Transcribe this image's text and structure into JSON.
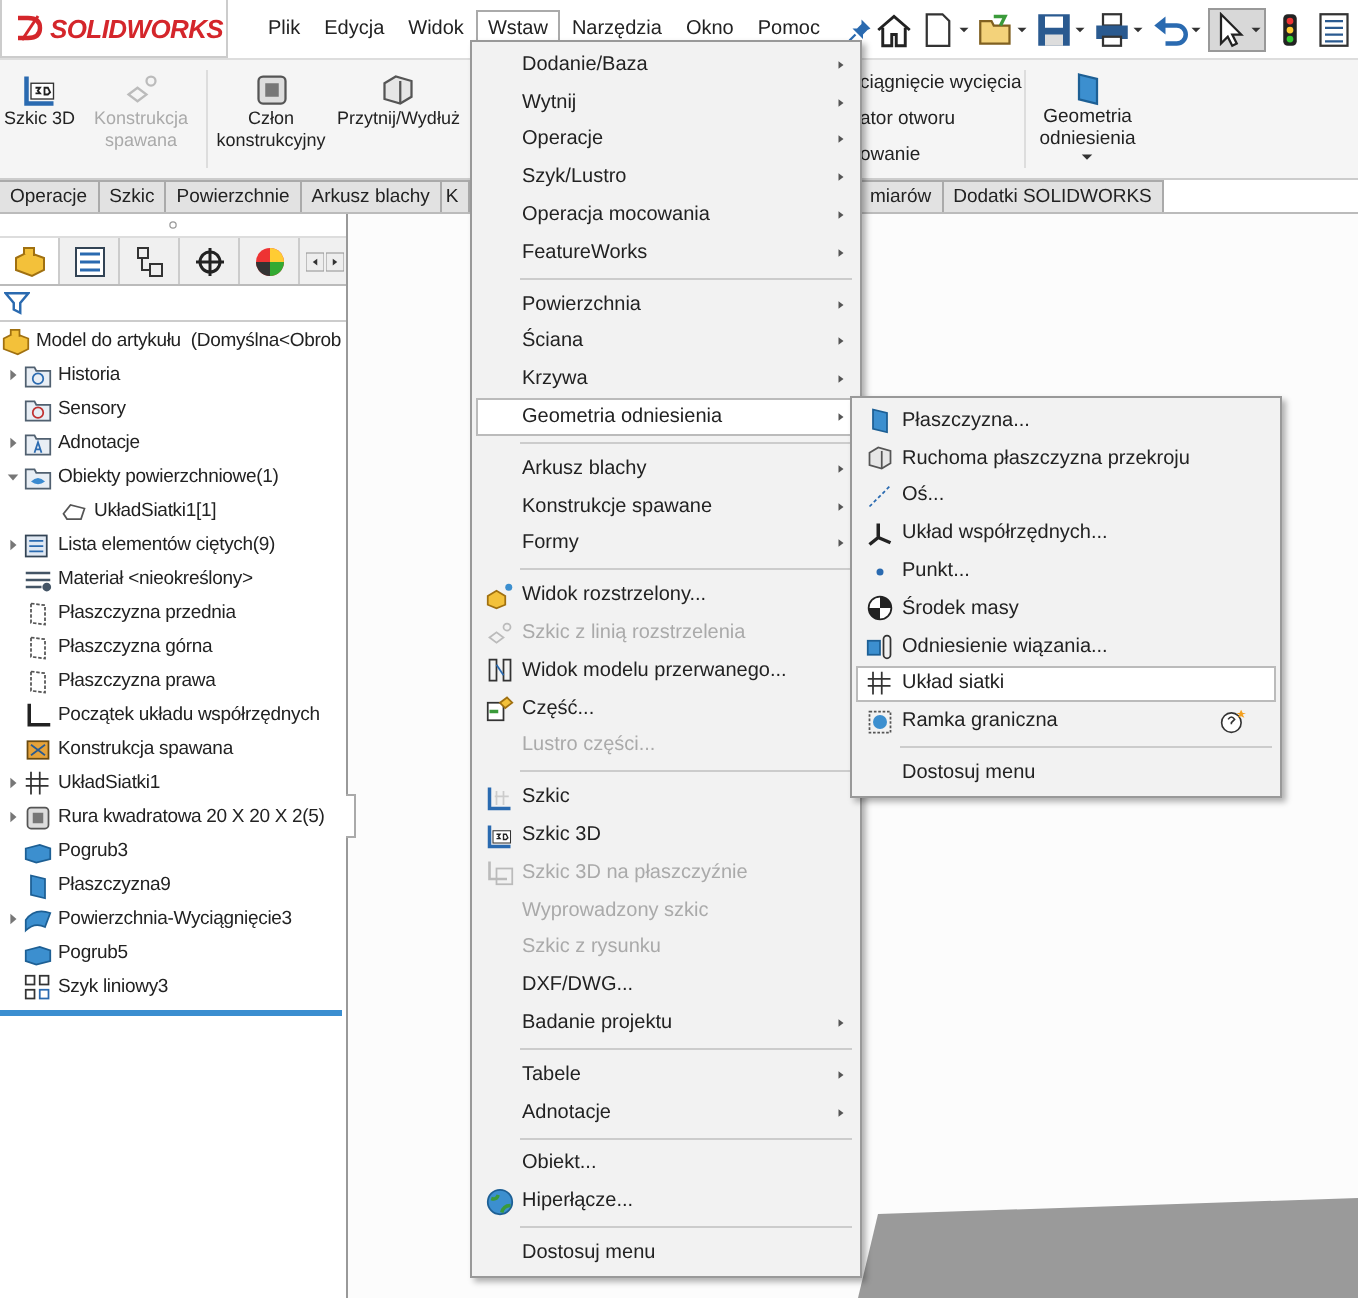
{
  "logo": {
    "text": "SOLIDWORKS"
  },
  "menu_bar": [
    {
      "label": "Plik",
      "selected": false
    },
    {
      "label": "Edycja",
      "selected": false
    },
    {
      "label": "Widok",
      "selected": false
    },
    {
      "label": "Wstaw",
      "selected": true
    },
    {
      "label": "Narzędzia",
      "selected": false
    },
    {
      "label": "Okno",
      "selected": false
    },
    {
      "label": "Pomoc",
      "selected": false
    }
  ],
  "ribbon": {
    "buttons": [
      {
        "label": "Szkic 3D",
        "kind": "sketch3d",
        "disabled": false
      },
      {
        "label": "Konstrukcja spawana",
        "kind": "weldment",
        "disabled": true
      },
      {
        "label": "Człon konstrukcyjny",
        "kind": "member",
        "disabled": false
      },
      {
        "label": "Przytnij/Wydłuż",
        "kind": "trim",
        "disabled": false
      }
    ],
    "partial_labels": [
      "ciągnięcie wycięcia",
      "ator otworu",
      "owanie"
    ],
    "geometry_button": {
      "label": "Geometria odniesienia"
    }
  },
  "ribbon_tabs": [
    "Operacje",
    "Szkic",
    "Powierzchnie",
    "Arkusz blachy",
    "K"
  ],
  "ribbon_tabs_right": [
    "miarów",
    "Dodatki SOLIDWORKS"
  ],
  "panel_tabs": [
    {
      "kind": "part",
      "selected": true
    },
    {
      "kind": "list",
      "selected": false
    },
    {
      "kind": "config",
      "selected": false
    },
    {
      "kind": "target",
      "selected": false
    },
    {
      "kind": "appearance",
      "selected": false
    }
  ],
  "feature_tree": {
    "root": {
      "label": "Model do artykułu  (Domyślna<Obrob",
      "kind": "part"
    },
    "items": [
      {
        "label": "Historia",
        "kind": "folder-history",
        "expanded": false
      },
      {
        "label": "Sensory",
        "kind": "folder-sensor"
      },
      {
        "label": "Adnotacje",
        "kind": "folder-annot",
        "expanded": false
      },
      {
        "label": "Obiekty powierzchniowe(1)",
        "kind": "folder-surface",
        "expanded": true,
        "children": [
          {
            "label": "UkładSiatki1[1]",
            "kind": "outline"
          }
        ]
      },
      {
        "label": "Lista elementów ciętych(9)",
        "kind": "cutlist",
        "expanded": false
      },
      {
        "label": "Materiał <nieokreślony>",
        "kind": "material"
      },
      {
        "label": "Płaszczyzna przednia",
        "kind": "plane"
      },
      {
        "label": "Płaszczyzna górna",
        "kind": "plane"
      },
      {
        "label": "Płaszczyzna prawa",
        "kind": "plane"
      },
      {
        "label": "Początek układu współrzędnych",
        "kind": "origin"
      },
      {
        "label": "Konstrukcja spawana",
        "kind": "weldment"
      },
      {
        "label": "UkładSiatki1",
        "kind": "grid",
        "expanded": false
      },
      {
        "label": "Rura kwadratowa 20 X 20 X 2(5)",
        "kind": "tube",
        "expanded": false
      },
      {
        "label": "Pogrub3",
        "kind": "thicken"
      },
      {
        "label": "Płaszczyzna9",
        "kind": "plane-solid"
      },
      {
        "label": "Powierzchnia-Wyciągnięcie3",
        "kind": "surface",
        "expanded": false
      },
      {
        "label": "Pogrub5",
        "kind": "thicken"
      },
      {
        "label": "Szyk liniowy3",
        "kind": "pattern"
      }
    ]
  },
  "insert_menu": {
    "items": [
      {
        "kind": "item",
        "label": "Dodanie/Baza",
        "submenu": true,
        "disabled": false,
        "selected": false
      },
      {
        "kind": "item",
        "label": "Wytnij",
        "submenu": true,
        "disabled": false,
        "selected": false
      },
      {
        "kind": "item",
        "label": "Operacje",
        "submenu": true,
        "disabled": false,
        "selected": false
      },
      {
        "kind": "item",
        "label": "Szyk/Lustro",
        "submenu": true,
        "disabled": false,
        "selected": false
      },
      {
        "kind": "item",
        "label": "Operacja mocowania",
        "submenu": true,
        "disabled": false,
        "selected": false
      },
      {
        "kind": "item",
        "label": "FeatureWorks",
        "submenu": true,
        "disabled": false,
        "selected": false
      },
      {
        "kind": "separator"
      },
      {
        "kind": "item",
        "label": "Powierzchnia",
        "submenu": true,
        "disabled": false,
        "selected": false
      },
      {
        "kind": "item",
        "label": "Ściana",
        "submenu": true,
        "disabled": false,
        "selected": false
      },
      {
        "kind": "item",
        "label": "Krzywa",
        "submenu": true,
        "disabled": false,
        "selected": false
      },
      {
        "kind": "item",
        "label": "Geometria odniesienia",
        "submenu": true,
        "disabled": false,
        "selected": true
      },
      {
        "kind": "separator"
      },
      {
        "kind": "item",
        "label": "Arkusz blachy",
        "submenu": true,
        "disabled": false,
        "selected": false
      },
      {
        "kind": "item",
        "label": "Konstrukcje spawane",
        "submenu": true,
        "disabled": false,
        "selected": false
      },
      {
        "kind": "item",
        "label": "Formy",
        "submenu": true,
        "disabled": false,
        "selected": false
      },
      {
        "kind": "separator"
      },
      {
        "kind": "exploded",
        "label": "Widok rozstrzelony...",
        "submenu": false,
        "disabled": false,
        "selected": false
      },
      {
        "kind": "explode-line",
        "label": "Szkic z linią rozstrzelenia",
        "submenu": false,
        "disabled": true,
        "selected": false
      },
      {
        "kind": "break",
        "label": "Widok modelu przerwanego...",
        "submenu": false,
        "disabled": false,
        "selected": false
      },
      {
        "kind": "part-insert",
        "label": "Część...",
        "submenu": false,
        "disabled": false,
        "selected": false
      },
      {
        "kind": "item",
        "label": "Lustro części...",
        "submenu": false,
        "disabled": true,
        "selected": false
      },
      {
        "kind": "separator"
      },
      {
        "kind": "sketch",
        "label": "Szkic",
        "submenu": false,
        "disabled": false,
        "selected": false
      },
      {
        "kind": "sketch3d",
        "label": "Szkic 3D",
        "submenu": false,
        "disabled": false,
        "selected": false
      },
      {
        "kind": "sketch3d-plane",
        "label": "Szkic 3D na płaszczyźnie",
        "submenu": false,
        "disabled": true,
        "selected": false
      },
      {
        "kind": "item",
        "label": "Wyprowadzony szkic",
        "submenu": false,
        "disabled": true,
        "selected": false
      },
      {
        "kind": "item",
        "label": "Szkic z rysunku",
        "submenu": false,
        "disabled": true,
        "selected": false
      },
      {
        "kind": "item",
        "label": "DXF/DWG...",
        "submenu": false,
        "disabled": false,
        "selected": false
      },
      {
        "kind": "item",
        "label": "Badanie projektu",
        "submenu": true,
        "disabled": false,
        "selected": false
      },
      {
        "kind": "separator"
      },
      {
        "kind": "item",
        "label": "Tabele",
        "submenu": true,
        "disabled": false,
        "selected": false
      },
      {
        "kind": "item",
        "label": "Adnotacje",
        "submenu": true,
        "disabled": false,
        "selected": false
      },
      {
        "kind": "separator"
      },
      {
        "kind": "item",
        "label": "Obiekt...",
        "submenu": false,
        "disabled": false,
        "selected": false
      },
      {
        "kind": "globe",
        "label": "Hiperłącze...",
        "submenu": false,
        "disabled": false,
        "selected": false
      },
      {
        "kind": "separator"
      },
      {
        "kind": "item",
        "label": "Dostosuj menu",
        "submenu": false,
        "disabled": false,
        "selected": false
      }
    ]
  },
  "geometry_submenu": {
    "items": [
      {
        "kind": "plane-solid",
        "label": "Płaszczyzna...",
        "submenu": false,
        "disabled": false,
        "selected": false
      },
      {
        "kind": "section",
        "label": "Ruchoma płaszczyzna przekroju",
        "submenu": false,
        "disabled": false,
        "selected": false
      },
      {
        "kind": "axis",
        "label": "Oś...",
        "submenu": false,
        "disabled": false,
        "selected": false
      },
      {
        "kind": "csys",
        "label": "Układ współrzędnych...",
        "submenu": false,
        "disabled": false,
        "selected": false
      },
      {
        "kind": "point",
        "label": "Punkt...",
        "submenu": false,
        "disabled": false,
        "selected": false
      },
      {
        "kind": "com",
        "label": "Środek masy",
        "submenu": false,
        "disabled": false,
        "selected": false
      },
      {
        "kind": "mate",
        "label": "Odniesienie wiązania...",
        "submenu": false,
        "disabled": false,
        "selected": false
      },
      {
        "kind": "grid",
        "label": "Układ siatki",
        "submenu": false,
        "disabled": false,
        "selected": true
      },
      {
        "kind": "bbox",
        "label": "Ramka graniczna",
        "help": true,
        "submenu": false,
        "disabled": false,
        "selected": false
      },
      {
        "kind": "separator"
      },
      {
        "kind": "item",
        "label": "Dostosuj menu",
        "submenu": false,
        "disabled": false,
        "selected": false
      }
    ]
  }
}
